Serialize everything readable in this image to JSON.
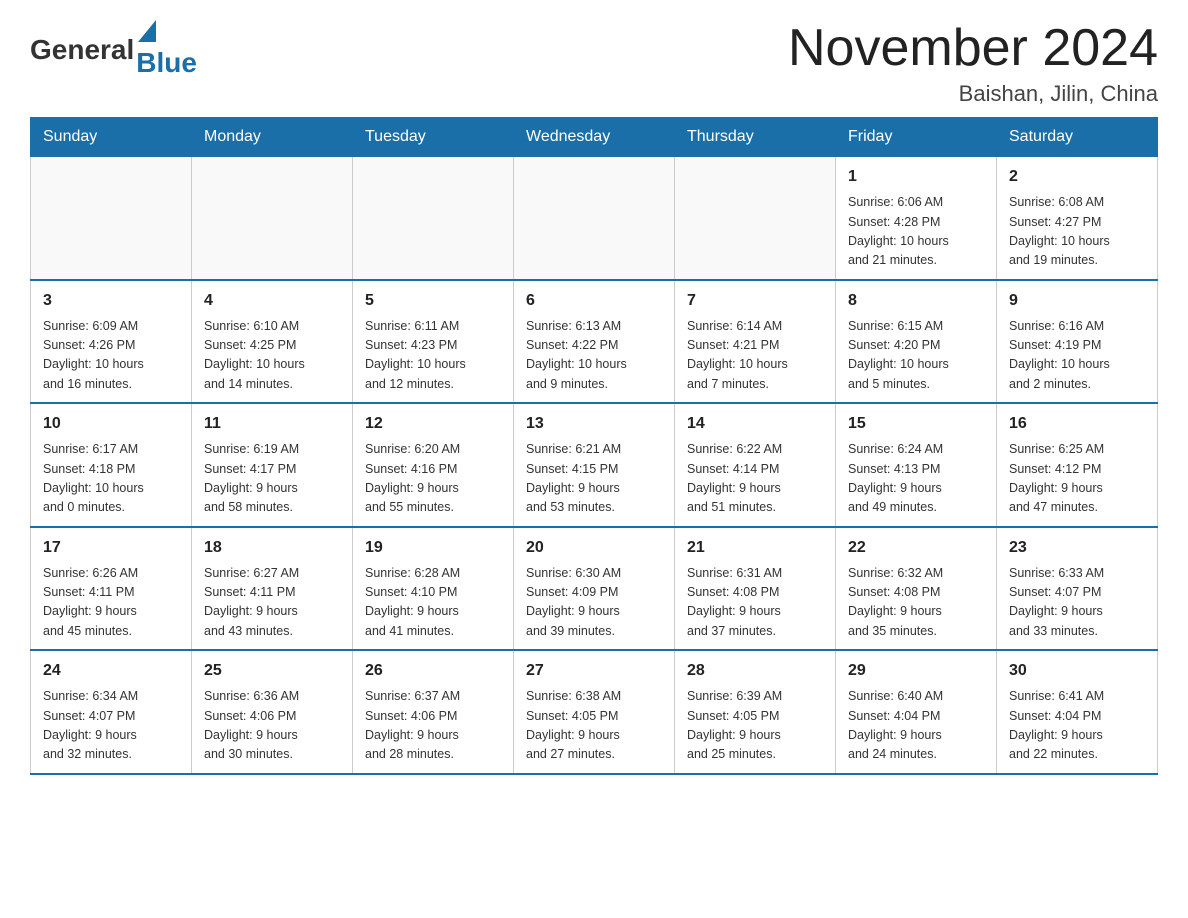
{
  "header": {
    "logo_general": "General",
    "logo_blue": "Blue",
    "month_title": "November 2024",
    "subtitle": "Baishan, Jilin, China"
  },
  "weekdays": [
    "Sunday",
    "Monday",
    "Tuesday",
    "Wednesday",
    "Thursday",
    "Friday",
    "Saturday"
  ],
  "weeks": [
    [
      {
        "day": "",
        "info": ""
      },
      {
        "day": "",
        "info": ""
      },
      {
        "day": "",
        "info": ""
      },
      {
        "day": "",
        "info": ""
      },
      {
        "day": "",
        "info": ""
      },
      {
        "day": "1",
        "info": "Sunrise: 6:06 AM\nSunset: 4:28 PM\nDaylight: 10 hours\nand 21 minutes."
      },
      {
        "day": "2",
        "info": "Sunrise: 6:08 AM\nSunset: 4:27 PM\nDaylight: 10 hours\nand 19 minutes."
      }
    ],
    [
      {
        "day": "3",
        "info": "Sunrise: 6:09 AM\nSunset: 4:26 PM\nDaylight: 10 hours\nand 16 minutes."
      },
      {
        "day": "4",
        "info": "Sunrise: 6:10 AM\nSunset: 4:25 PM\nDaylight: 10 hours\nand 14 minutes."
      },
      {
        "day": "5",
        "info": "Sunrise: 6:11 AM\nSunset: 4:23 PM\nDaylight: 10 hours\nand 12 minutes."
      },
      {
        "day": "6",
        "info": "Sunrise: 6:13 AM\nSunset: 4:22 PM\nDaylight: 10 hours\nand 9 minutes."
      },
      {
        "day": "7",
        "info": "Sunrise: 6:14 AM\nSunset: 4:21 PM\nDaylight: 10 hours\nand 7 minutes."
      },
      {
        "day": "8",
        "info": "Sunrise: 6:15 AM\nSunset: 4:20 PM\nDaylight: 10 hours\nand 5 minutes."
      },
      {
        "day": "9",
        "info": "Sunrise: 6:16 AM\nSunset: 4:19 PM\nDaylight: 10 hours\nand 2 minutes."
      }
    ],
    [
      {
        "day": "10",
        "info": "Sunrise: 6:17 AM\nSunset: 4:18 PM\nDaylight: 10 hours\nand 0 minutes."
      },
      {
        "day": "11",
        "info": "Sunrise: 6:19 AM\nSunset: 4:17 PM\nDaylight: 9 hours\nand 58 minutes."
      },
      {
        "day": "12",
        "info": "Sunrise: 6:20 AM\nSunset: 4:16 PM\nDaylight: 9 hours\nand 55 minutes."
      },
      {
        "day": "13",
        "info": "Sunrise: 6:21 AM\nSunset: 4:15 PM\nDaylight: 9 hours\nand 53 minutes."
      },
      {
        "day": "14",
        "info": "Sunrise: 6:22 AM\nSunset: 4:14 PM\nDaylight: 9 hours\nand 51 minutes."
      },
      {
        "day": "15",
        "info": "Sunrise: 6:24 AM\nSunset: 4:13 PM\nDaylight: 9 hours\nand 49 minutes."
      },
      {
        "day": "16",
        "info": "Sunrise: 6:25 AM\nSunset: 4:12 PM\nDaylight: 9 hours\nand 47 minutes."
      }
    ],
    [
      {
        "day": "17",
        "info": "Sunrise: 6:26 AM\nSunset: 4:11 PM\nDaylight: 9 hours\nand 45 minutes."
      },
      {
        "day": "18",
        "info": "Sunrise: 6:27 AM\nSunset: 4:11 PM\nDaylight: 9 hours\nand 43 minutes."
      },
      {
        "day": "19",
        "info": "Sunrise: 6:28 AM\nSunset: 4:10 PM\nDaylight: 9 hours\nand 41 minutes."
      },
      {
        "day": "20",
        "info": "Sunrise: 6:30 AM\nSunset: 4:09 PM\nDaylight: 9 hours\nand 39 minutes."
      },
      {
        "day": "21",
        "info": "Sunrise: 6:31 AM\nSunset: 4:08 PM\nDaylight: 9 hours\nand 37 minutes."
      },
      {
        "day": "22",
        "info": "Sunrise: 6:32 AM\nSunset: 4:08 PM\nDaylight: 9 hours\nand 35 minutes."
      },
      {
        "day": "23",
        "info": "Sunrise: 6:33 AM\nSunset: 4:07 PM\nDaylight: 9 hours\nand 33 minutes."
      }
    ],
    [
      {
        "day": "24",
        "info": "Sunrise: 6:34 AM\nSunset: 4:07 PM\nDaylight: 9 hours\nand 32 minutes."
      },
      {
        "day": "25",
        "info": "Sunrise: 6:36 AM\nSunset: 4:06 PM\nDaylight: 9 hours\nand 30 minutes."
      },
      {
        "day": "26",
        "info": "Sunrise: 6:37 AM\nSunset: 4:06 PM\nDaylight: 9 hours\nand 28 minutes."
      },
      {
        "day": "27",
        "info": "Sunrise: 6:38 AM\nSunset: 4:05 PM\nDaylight: 9 hours\nand 27 minutes."
      },
      {
        "day": "28",
        "info": "Sunrise: 6:39 AM\nSunset: 4:05 PM\nDaylight: 9 hours\nand 25 minutes."
      },
      {
        "day": "29",
        "info": "Sunrise: 6:40 AM\nSunset: 4:04 PM\nDaylight: 9 hours\nand 24 minutes."
      },
      {
        "day": "30",
        "info": "Sunrise: 6:41 AM\nSunset: 4:04 PM\nDaylight: 9 hours\nand 22 minutes."
      }
    ]
  ]
}
